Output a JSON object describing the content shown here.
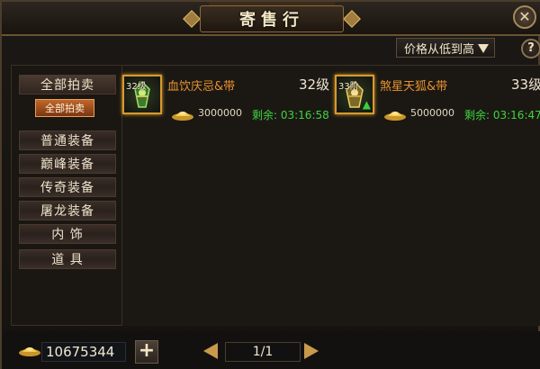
{
  "window": {
    "title": "寄售行"
  },
  "sort": {
    "selected": "价格从低到高"
  },
  "help_label": "?",
  "categories": [
    {
      "label": "全部拍卖"
    },
    {
      "label": "普通装备"
    },
    {
      "label": "巅峰装备"
    },
    {
      "label": "传奇装备"
    },
    {
      "label": "屠龙装备"
    },
    {
      "label": "内 饰"
    },
    {
      "label": "道 具"
    }
  ],
  "sub_category": {
    "label": "全部拍卖"
  },
  "listings": [
    {
      "icon": "belt-item-icon",
      "badge": "32级",
      "name": "血饮庆忌&带",
      "level": "32级",
      "price": "3000000",
      "time_label": "剩余: 03:16:58"
    },
    {
      "icon": "belt-item-icon",
      "badge": "33阶",
      "name": "煞星天狐&带",
      "level": "33级",
      "price": "5000000",
      "time_label": "剩余: 03:16:47"
    }
  ],
  "footer": {
    "gold_amount": "10675344",
    "add_label": "+",
    "page": "1/1"
  },
  "colors": {
    "accent": "#e7922f",
    "timer": "#3fd33f",
    "frame": "#d89a2c"
  }
}
